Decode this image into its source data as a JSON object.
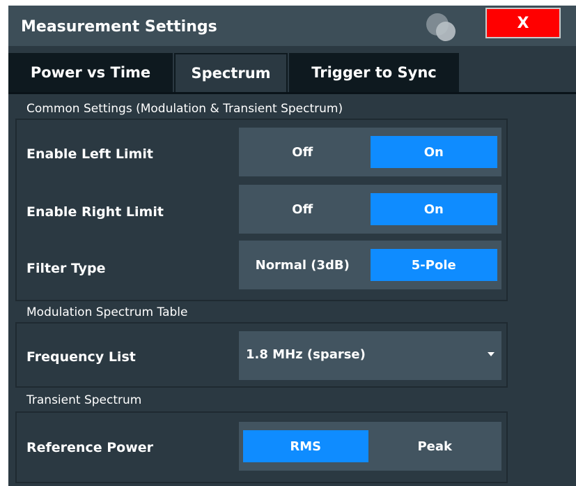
{
  "window": {
    "title": "Measurement Settings",
    "close_label": "X"
  },
  "tabs": [
    {
      "label": "Power vs Time",
      "active": false
    },
    {
      "label": "Spectrum",
      "active": true
    },
    {
      "label": "Trigger to Sync",
      "active": false
    }
  ],
  "common": {
    "title": "Common Settings (Modulation & Transient Spectrum)",
    "enable_left_limit": {
      "label": "Enable Left Limit",
      "options": [
        "Off",
        "On"
      ],
      "selected": "On"
    },
    "enable_right_limit": {
      "label": "Enable Right Limit",
      "options": [
        "Off",
        "On"
      ],
      "selected": "On"
    },
    "filter_type": {
      "label": "Filter Type",
      "options": [
        "Normal (3dB)",
        "5-Pole"
      ],
      "selected": "5-Pole"
    }
  },
  "modulation_table": {
    "title": "Modulation Spectrum Table",
    "frequency_list": {
      "label": "Frequency List",
      "value": "1.8 MHz (sparse)"
    }
  },
  "transient": {
    "title": "Transient Spectrum",
    "reference_power": {
      "label": "Reference Power",
      "options": [
        "RMS",
        "Peak"
      ],
      "selected": "RMS"
    }
  },
  "colors": {
    "dialog_bg": "#2b3942",
    "control_bg": "#425460",
    "selected": "#0f8cff",
    "close": "#ff0000",
    "tab_inactive": "#0e191f"
  },
  "icons": {
    "close": "close-icon",
    "logo": "overlapping-circles-logo-icon",
    "dropdown": "caret-down-icon"
  }
}
